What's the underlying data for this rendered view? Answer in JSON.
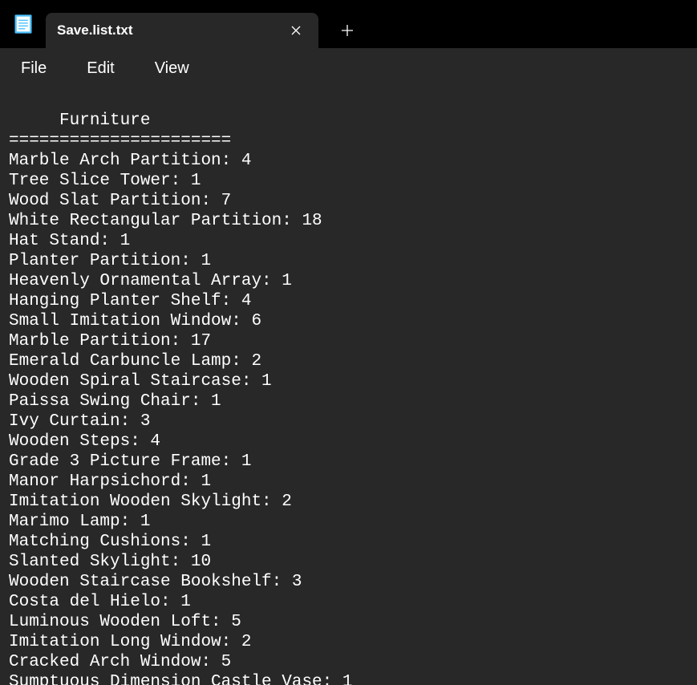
{
  "app": {
    "tab_title": "Save.list.txt"
  },
  "menu": {
    "file": "File",
    "edit": "Edit",
    "view": "View"
  },
  "content": {
    "header": "     Furniture",
    "divider": "======================",
    "items": [
      {
        "name": "Marble Arch Partition",
        "count": 4
      },
      {
        "name": "Tree Slice Tower",
        "count": 1
      },
      {
        "name": "Wood Slat Partition",
        "count": 7
      },
      {
        "name": "White Rectangular Partition",
        "count": 18
      },
      {
        "name": "Hat Stand",
        "count": 1
      },
      {
        "name": "Planter Partition",
        "count": 1
      },
      {
        "name": "Heavenly Ornamental Array",
        "count": 1
      },
      {
        "name": "Hanging Planter Shelf",
        "count": 4
      },
      {
        "name": "Small Imitation Window",
        "count": 6
      },
      {
        "name": "Marble Partition",
        "count": 17
      },
      {
        "name": "Emerald Carbuncle Lamp",
        "count": 2
      },
      {
        "name": "Wooden Spiral Staircase",
        "count": 1
      },
      {
        "name": "Paissa Swing Chair",
        "count": 1
      },
      {
        "name": "Ivy Curtain",
        "count": 3
      },
      {
        "name": "Wooden Steps",
        "count": 4
      },
      {
        "name": "Grade 3 Picture Frame",
        "count": 1
      },
      {
        "name": "Manor Harpsichord",
        "count": 1
      },
      {
        "name": "Imitation Wooden Skylight",
        "count": 2
      },
      {
        "name": "Marimo Lamp",
        "count": 1
      },
      {
        "name": "Matching Cushions",
        "count": 1
      },
      {
        "name": "Slanted Skylight",
        "count": 10
      },
      {
        "name": "Wooden Staircase Bookshelf",
        "count": 3
      },
      {
        "name": "Costa del Hielo",
        "count": 1
      },
      {
        "name": "Luminous Wooden Loft",
        "count": 5
      },
      {
        "name": "Imitation Long Window",
        "count": 2
      },
      {
        "name": "Cracked Arch Window",
        "count": 5
      },
      {
        "name": "Sumptuous Dimension Castle Vase",
        "count": 1
      }
    ]
  }
}
